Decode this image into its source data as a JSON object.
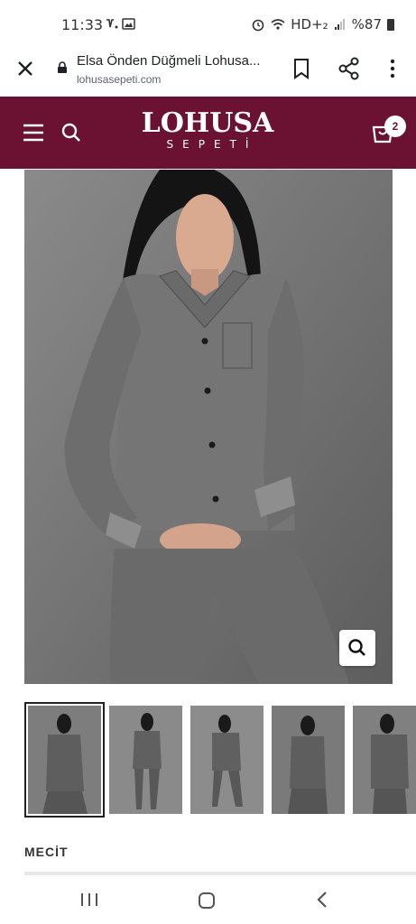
{
  "status": {
    "time": "11:33",
    "left_icons": "notification-icon gallery-icon",
    "right_text": "HD+₂",
    "battery": "%87"
  },
  "browser": {
    "tab_title": "Elsa Önden Düğmeli Lohusa...",
    "url": "lohusasepeti.com",
    "icons": [
      "close-icon",
      "lock-icon",
      "bookmark-icon",
      "share-icon",
      "more-icon"
    ]
  },
  "site": {
    "logo_main": "LOHUSA",
    "logo_sub": "SEPETİ",
    "cart_count": "2",
    "header_color": "#6b1233",
    "icons": [
      "menu-icon",
      "search-icon",
      "cart-icon"
    ]
  },
  "product": {
    "brand": "MECİT",
    "thumbnail_count": 5,
    "active_thumbnail": 1
  },
  "nav": {
    "icons": [
      "recent-apps-icon",
      "home-icon",
      "back-icon"
    ]
  }
}
